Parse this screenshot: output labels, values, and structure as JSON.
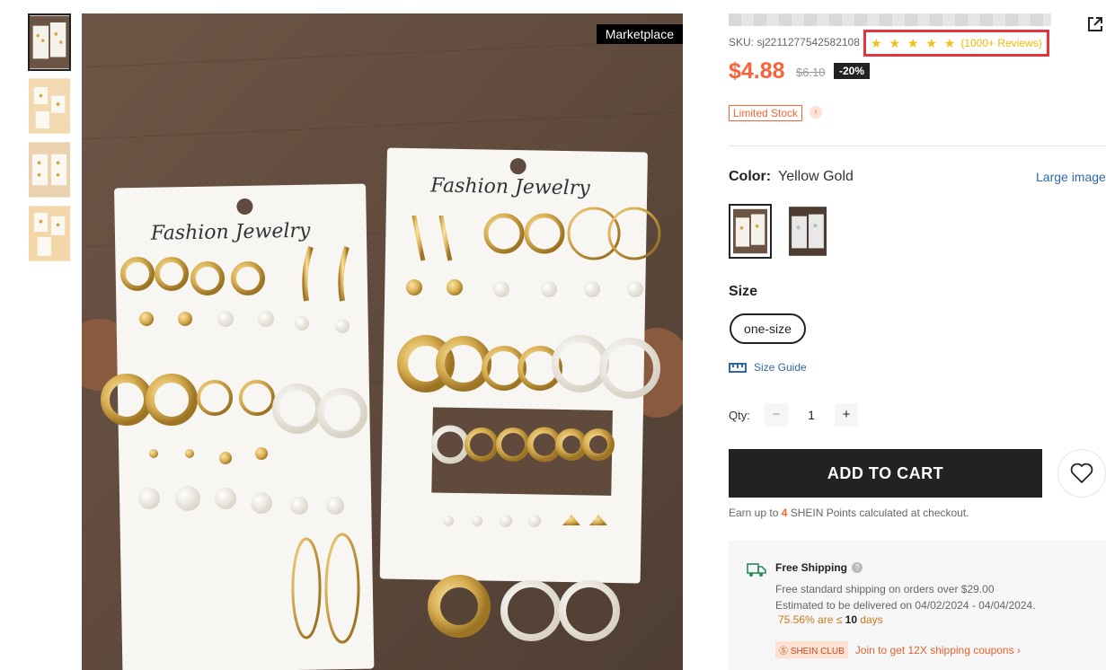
{
  "gallery": {
    "thumbnails": [
      "thumbnail-1",
      "thumbnail-2",
      "thumbnail-3",
      "thumbnail-4"
    ],
    "badge": "Marketplace",
    "card_text": "Fashion Jewelry"
  },
  "product": {
    "sku": "SKU: sj2211277542582108",
    "stars": "★ ★ ★ ★ ★",
    "reviews": "(1000+ Reviews)",
    "price": "$4.88",
    "original_price": "$6.10",
    "discount": "-20%",
    "stock_badge": "Limited Stock",
    "stock_arrow": "›"
  },
  "color": {
    "label": "Color:",
    "value": "Yellow Gold",
    "large_image_link": "Large image"
  },
  "size": {
    "label": "Size",
    "option": "one-size",
    "guide": "Size Guide"
  },
  "quantity": {
    "label": "Qty:",
    "minus": "−",
    "value": "1",
    "plus": "+"
  },
  "cart": {
    "add_button": "ADD TO CART",
    "points_prefix": "Earn up to ",
    "points_value": "4",
    "points_suffix": " SHEIN Points calculated at checkout."
  },
  "shipping": {
    "title": "Free Shipping",
    "help": "?",
    "standard": "Free standard shipping on orders over $29.00",
    "estimate": "Estimated to be delivered on 04/02/2024 - 04/04/2024.",
    "pct": "75.56% are ≤ ",
    "days_num": "10",
    "days_word": " days",
    "club_badge": "Ⓢ SHEIN CLUB",
    "club_text": "Join to get 12X shipping coupons ›"
  },
  "colors": {
    "price": "#fa6338",
    "star": "#f2c014",
    "highlight_box": "#e8333e",
    "link": "#2d68a8",
    "button": "#222222"
  }
}
